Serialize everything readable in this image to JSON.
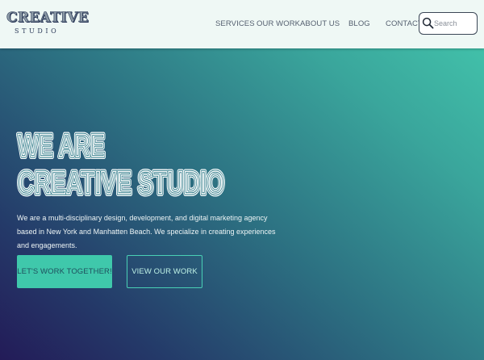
{
  "header": {
    "logo": {
      "top": "CREATIVE",
      "bottom": "STUDIO"
    },
    "nav": [
      {
        "label": "SERVICES"
      },
      {
        "label": "OUR WORK"
      },
      {
        "label": "ABOUT US"
      },
      {
        "label": "BLOG"
      },
      {
        "label": "CONTACT"
      }
    ],
    "search": {
      "placeholder": "Search",
      "value": ""
    }
  },
  "hero": {
    "title_line1": "WE ARE",
    "title_line2": "CREATIVE STUDIO",
    "description": "We are a multi-disciplinary design, development, and digital marketing agency based in New York and Manhatten Beach. We specialize in creating experiences and engagements.",
    "primary_button": "LET'S WORK TOGETHER!",
    "secondary_button": "VIEW OUR WORK"
  },
  "colors": {
    "accent": "#3fc8ab",
    "header_bg": "#eff8f5",
    "gradient_top_right": "#44c9ae",
    "gradient_bottom_left": "#231b58",
    "nav_text": "#556070"
  },
  "icons": {
    "search": "search-icon"
  }
}
